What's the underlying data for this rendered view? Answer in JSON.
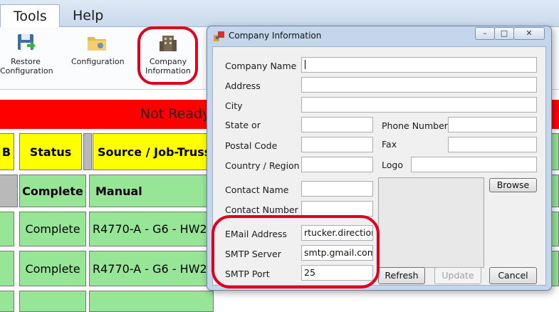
{
  "menu": {
    "tools": "Tools",
    "help": "Help"
  },
  "ribbon": {
    "restore_line1": "Restore",
    "restore_line2": "Configuration",
    "configuration": "Configuration",
    "company_line1": "Company",
    "company_line2": "Information"
  },
  "status_text": "Not Ready",
  "grid": {
    "col_b": "B",
    "col_status": "Status",
    "col_source": "Source / Job-Truss",
    "rows": [
      {
        "status": "Complete",
        "source": "Manual"
      },
      {
        "status": "Complete",
        "source": "R4770-A - G6 - HW2"
      },
      {
        "status": "Complete",
        "source": "R4770-A - G6 - HW2"
      }
    ]
  },
  "dialog": {
    "title": "Company Information",
    "labels": {
      "company_name": "Company Name",
      "address": "Address",
      "city": "City",
      "state": "State or",
      "postal": "Postal Code",
      "country": "Country / Region",
      "phone": "Phone Number",
      "fax": "Fax",
      "logo": "Logo",
      "contact_name": "Contact Name",
      "contact_number": "Contact Number",
      "email": "EMail Address",
      "smtp_server": "SMTP Server",
      "smtp_port": "SMTP Port"
    },
    "values": {
      "company_name": "",
      "email": "rtucker.direction",
      "smtp_server": "smtp.gmail.com",
      "smtp_port": "25"
    },
    "buttons": {
      "browse": "Browse",
      "refresh": "Refresh",
      "update": "Update",
      "cancel": "Cancel"
    }
  },
  "colors": {
    "highlight_oval": "#e0001b",
    "header_yellow": "#ffff00",
    "row_green": "#97e597",
    "status_red": "#ff0000"
  }
}
